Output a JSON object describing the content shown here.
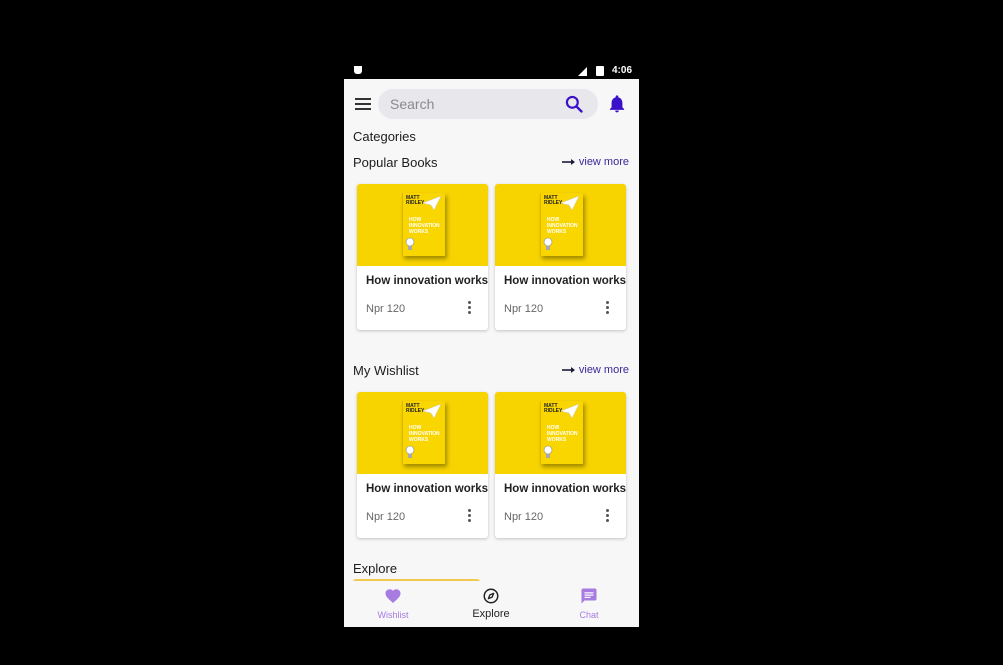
{
  "status_bar": {
    "time": "4:06"
  },
  "search": {
    "placeholder": "Search"
  },
  "sections": {
    "categories": {
      "title": "Categories"
    },
    "popular": {
      "title": "Popular Books",
      "view_more": "view more"
    },
    "wishlist": {
      "title": "My Wishlist",
      "view_more": "view more"
    },
    "explore": {
      "title": "Explore"
    }
  },
  "book_cover": {
    "author": "MATT RIDLEY",
    "title": "HOW INNOVATION WORKS"
  },
  "popular_books": [
    {
      "title": "How innovation works",
      "price": "Npr 120"
    },
    {
      "title": "How innovation works",
      "price": "Npr 120"
    }
  ],
  "wishlist_books": [
    {
      "title": "How innovation works",
      "price": "Npr 120"
    },
    {
      "title": "How innovation works",
      "price": "Npr 120"
    }
  ],
  "bottom_nav": {
    "wishlist": "Wishlist",
    "explore": "Explore",
    "chat": "Chat"
  },
  "colors": {
    "accent": "#3a10c8",
    "nav_inactive": "#a77be0",
    "cover_yellow": "#f7d300"
  },
  "icons": [
    "menu-icon",
    "search-icon",
    "bell-icon",
    "arrow-right-icon",
    "more-vert-icon",
    "heart-icon",
    "compass-icon",
    "chat-icon"
  ]
}
